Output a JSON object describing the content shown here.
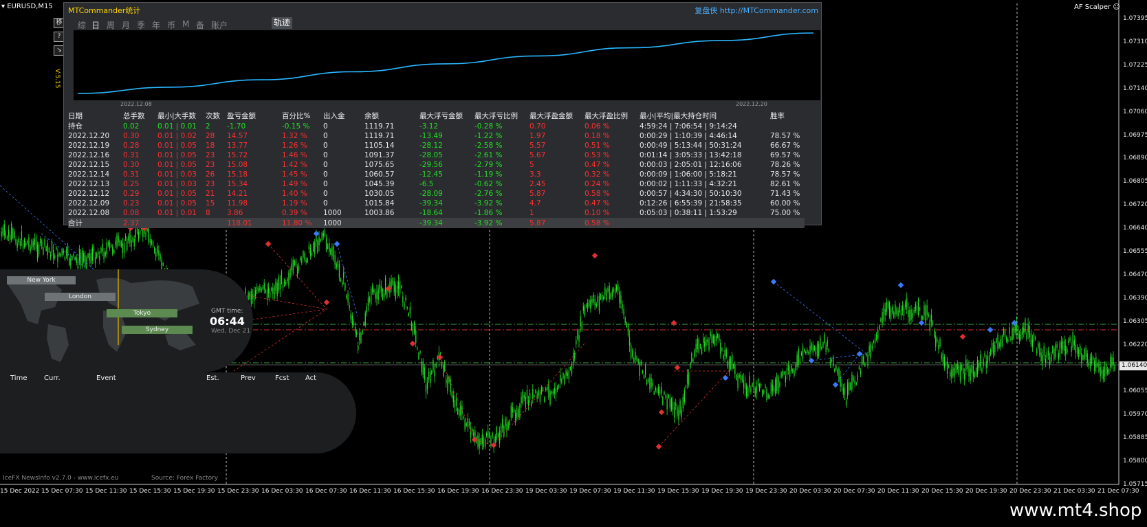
{
  "chart": {
    "symbol": "EURUSD,M15",
    "indicator": "AF Scalper ☺",
    "current_price": "1.06140",
    "price_scale": [
      "1.07395",
      "1.07310",
      "1.07225",
      "1.07140",
      "1.07060",
      "1.06975",
      "1.06890",
      "1.06805",
      "1.06720",
      "1.06640",
      "1.06555",
      "1.06470",
      "1.06390",
      "1.06305",
      "1.06220",
      "1.06140",
      "1.06055",
      "1.05970",
      "1.05885",
      "1.05800",
      "1.05715"
    ],
    "time_scale": [
      "15 Dec 2022",
      "15 Dec 07:30",
      "15 Dec 11:30",
      "15 Dec 15:30",
      "15 Dec 19:30",
      "15 Dec 23:30",
      "16 Dec 03:30",
      "16 Dec 07:30",
      "16 Dec 11:30",
      "16 Dec 15:30",
      "16 Dec 19:30",
      "16 Dec 23:30",
      "19 Dec 03:30",
      "19 Dec 07:30",
      "19 Dec 11:30",
      "19 Dec 15:30",
      "19 Dec 19:30",
      "19 Dec 23:30",
      "20 Dec 03:30",
      "20 Dec 07:30",
      "20 Dec 11:30",
      "20 Dec 15:30",
      "20 Dec 19:30",
      "20 Dec 23:30",
      "21 Dec 03:30",
      "21 Dec 07:30"
    ],
    "colors": {
      "bull": "#22e022",
      "bear": "#22e022",
      "level_green": "#3aa83a",
      "level_red": "#e03030"
    }
  },
  "mtc": {
    "title": "MTCommander统计",
    "link": "复盘侠 http://MTCommander.com",
    "tabs": [
      "综",
      "日",
      "周",
      "月",
      "季",
      "年",
      "币",
      "M",
      "备",
      "账户"
    ],
    "active_tab": "日",
    "track_tab": "轨迹",
    "side_buttons": [
      "移",
      "?",
      "↘"
    ],
    "version": "V:5.15",
    "equity_start_date": "2022.12.08",
    "equity_end_date": "2022.12.20",
    "equity_curve": [
      1003.86,
      1015.84,
      1030.05,
      1045.39,
      1060.57,
      1075.65,
      1091.37,
      1105.14,
      1119.71
    ],
    "headers": [
      "日期",
      "总手数",
      "最小|大手数",
      "次数",
      "盈亏金额",
      "百分比%",
      "出入金",
      "余额",
      "最大浮亏金额",
      "最大浮亏比例",
      "最大浮盈金额",
      "最大浮盈比例",
      "最小|平均|最大持仓时间",
      "胜率"
    ],
    "holding": [
      "持仓",
      "0.02",
      "0.01 | 0.01",
      "2",
      "-1.70",
      "-0.15 %",
      "0",
      "1119.71",
      "-3.12",
      "-0.28 %",
      "0.70",
      "0.06 %",
      "4:59:24 | 7:06:54 | 9:14:24",
      ""
    ],
    "rows": [
      [
        "2022.12.20",
        "0.30",
        "0.01 | 0.02",
        "28",
        "14.57",
        "1.32 %",
        "0",
        "1119.71",
        "-13.49",
        "-1.22 %",
        "1.97",
        "0.18 %",
        "0:00:29 | 1:10:39 | 4:46:14",
        "78.57 %"
      ],
      [
        "2022.12.19",
        "0.28",
        "0.01 | 0.05",
        "18",
        "13.77",
        "1.26 %",
        "0",
        "1105.14",
        "-28.12",
        "-2.58 %",
        "5.57",
        "0.51 %",
        "0:00:49 | 5:13:44 | 50:31:24",
        "66.67 %"
      ],
      [
        "2022.12.16",
        "0.31",
        "0.01 | 0.05",
        "23",
        "15.72",
        "1.46 %",
        "0",
        "1091.37",
        "-28.05",
        "-2.61 %",
        "5.67",
        "0.53 %",
        "0:01:14 | 3:05:33 | 13:42:18",
        "69.57 %"
      ],
      [
        "2022.12.15",
        "0.30",
        "0.01 | 0.05",
        "23",
        "15.08",
        "1.42 %",
        "0",
        "1075.65",
        "-29.56",
        "-2.79 %",
        "5",
        "0.47 %",
        "0:00:03 | 2:05:01 | 12:16:06",
        "78.26 %"
      ],
      [
        "2022.12.14",
        "0.31",
        "0.01 | 0.03",
        "26",
        "15.18",
        "1.45 %",
        "0",
        "1060.57",
        "-12.45",
        "-1.19 %",
        "3.3",
        "0.32 %",
        "0:00:09 | 1:06:00 | 5:18:21",
        "78.57 %"
      ],
      [
        "2022.12.13",
        "0.25",
        "0.01 | 0.03",
        "23",
        "15.34",
        "1.49 %",
        "0",
        "1045.39",
        "-6.5",
        "-0.62 %",
        "2.45",
        "0.24 %",
        "0:00:02 | 1:11:33 | 4:32:21",
        "82.61 %"
      ],
      [
        "2022.12.12",
        "0.29",
        "0.01 | 0.05",
        "21",
        "14.21",
        "1.40 %",
        "0",
        "1030.05",
        "-28.09",
        "-2.76 %",
        "5.87",
        "0.58 %",
        "0:00:57 | 4:34:30 | 50:10:30",
        "71.43 %"
      ],
      [
        "2022.12.09",
        "0.23",
        "0.01 | 0.05",
        "15",
        "11.98",
        "1.19 %",
        "0",
        "1015.84",
        "-39.34",
        "-3.92 %",
        "4.7",
        "0.47 %",
        "0:12:26 | 6:55:39 | 21:58:35",
        "60.00 %"
      ],
      [
        "2022.12.08",
        "0.08",
        "0.01 | 0.01",
        "8",
        "3.86",
        "0.39 %",
        "1000",
        "1003.86",
        "-18.64",
        "-1.86 %",
        "1",
        "0.10 %",
        "0:05:03 | 0:38:11 | 1:53:29",
        "75.00 %"
      ]
    ],
    "total": [
      "合计",
      "2.37",
      "",
      "",
      "118.01",
      "11.80 %",
      "1000",
      "",
      "-39.34",
      "-3.92 %",
      "5.87",
      "0.58 %",
      "",
      ""
    ]
  },
  "news": {
    "sessions": [
      "New York",
      "London",
      "Tokyo",
      "Sydney"
    ],
    "gmt_label": "GMT time:",
    "gmt_time": "06:44",
    "gmt_date": "Wed, Dec 21",
    "columns": [
      "Time",
      "Curr.",
      "Event",
      "Est.",
      "Prev",
      "Fcst",
      "Act"
    ],
    "credit": "IceFX NewsInfo v2.7.0  -  www.icefx.eu",
    "source": "Source: Forex Factory"
  },
  "watermark": "www.mt4.shop"
}
